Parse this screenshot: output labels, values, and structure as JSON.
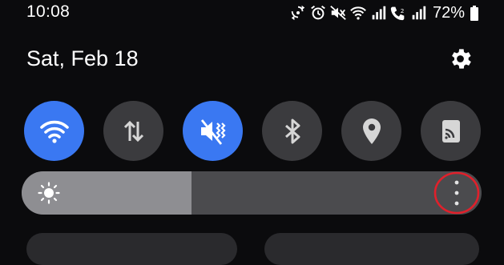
{
  "status_bar": {
    "time": "10:08",
    "battery_percent": "72%",
    "icons": [
      "sync-icon",
      "alarm-icon",
      "mute-icon",
      "wifi-icon",
      "signal-icon",
      "wifi-calling-sim2-icon",
      "signal-icon",
      "battery-icon"
    ]
  },
  "header": {
    "date": "Sat, Feb 18",
    "settings_icon": "gear-icon"
  },
  "quick_tiles": [
    {
      "name": "wifi",
      "icon": "wifi-icon",
      "state": "on"
    },
    {
      "name": "mobile-data",
      "icon": "data-arrows-icon",
      "state": "off"
    },
    {
      "name": "sound",
      "icon": "vibrate-mute-icon",
      "state": "on"
    },
    {
      "name": "bluetooth",
      "icon": "bluetooth-icon",
      "state": "off"
    },
    {
      "name": "location",
      "icon": "location-pin-icon",
      "state": "off"
    },
    {
      "name": "smart-view",
      "icon": "cast-icon",
      "state": "off"
    }
  ],
  "brightness": {
    "level": 0.37,
    "icon": "sun-icon",
    "more_options_icon": "more-vertical-icon",
    "highlight_color": "#e0202b"
  },
  "colors": {
    "accent": "#3a78f2",
    "tile_off": "#3b3b3e",
    "background": "#0b0b0d"
  }
}
